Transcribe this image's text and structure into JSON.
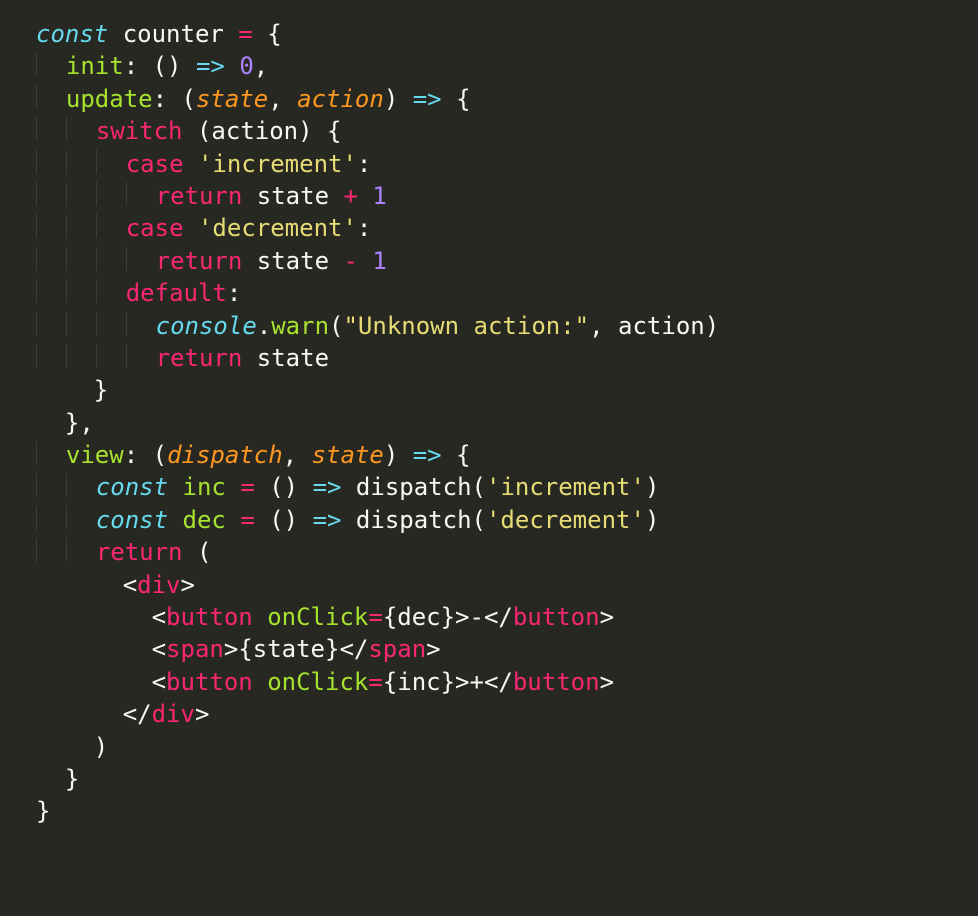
{
  "code": {
    "lines": [
      [
        {
          "cls": "kw-decl",
          "t": "const"
        },
        {
          "cls": "plain",
          "t": " counter "
        },
        {
          "cls": "kw",
          "t": "="
        },
        {
          "cls": "plain",
          "t": " {"
        }
      ],
      [
        {
          "cls": "plain",
          "t": "  "
        },
        {
          "cls": "fname",
          "t": "init"
        },
        {
          "cls": "plain",
          "t": ": () "
        },
        {
          "cls": "kw-decl",
          "t": "=>"
        },
        {
          "cls": "plain",
          "t": " "
        },
        {
          "cls": "num",
          "t": "0"
        },
        {
          "cls": "plain",
          "t": ","
        }
      ],
      [
        {
          "cls": "plain",
          "t": "  "
        },
        {
          "cls": "fname",
          "t": "update"
        },
        {
          "cls": "plain",
          "t": ": ("
        },
        {
          "cls": "param",
          "t": "state"
        },
        {
          "cls": "plain",
          "t": ", "
        },
        {
          "cls": "param",
          "t": "action"
        },
        {
          "cls": "plain",
          "t": ") "
        },
        {
          "cls": "kw-decl",
          "t": "=>"
        },
        {
          "cls": "plain",
          "t": " {"
        }
      ],
      [
        {
          "cls": "plain",
          "t": "    "
        },
        {
          "cls": "kw",
          "t": "switch"
        },
        {
          "cls": "plain",
          "t": " (action) {"
        }
      ],
      [
        {
          "cls": "plain",
          "t": "      "
        },
        {
          "cls": "kw",
          "t": "case"
        },
        {
          "cls": "plain",
          "t": " "
        },
        {
          "cls": "str",
          "t": "'increment'"
        },
        {
          "cls": "plain",
          "t": ":"
        }
      ],
      [
        {
          "cls": "plain",
          "t": "        "
        },
        {
          "cls": "kw",
          "t": "return"
        },
        {
          "cls": "plain",
          "t": " state "
        },
        {
          "cls": "kw",
          "t": "+"
        },
        {
          "cls": "plain",
          "t": " "
        },
        {
          "cls": "num",
          "t": "1"
        }
      ],
      [
        {
          "cls": "plain",
          "t": "      "
        },
        {
          "cls": "kw",
          "t": "case"
        },
        {
          "cls": "plain",
          "t": " "
        },
        {
          "cls": "str",
          "t": "'decrement'"
        },
        {
          "cls": "plain",
          "t": ":"
        }
      ],
      [
        {
          "cls": "plain",
          "t": "        "
        },
        {
          "cls": "kw",
          "t": "return"
        },
        {
          "cls": "plain",
          "t": " state "
        },
        {
          "cls": "kw",
          "t": "-"
        },
        {
          "cls": "plain",
          "t": " "
        },
        {
          "cls": "num",
          "t": "1"
        }
      ],
      [
        {
          "cls": "plain",
          "t": "      "
        },
        {
          "cls": "kw",
          "t": "default"
        },
        {
          "cls": "plain",
          "t": ":"
        }
      ],
      [
        {
          "cls": "plain",
          "t": "        "
        },
        {
          "cls": "obj-ital",
          "t": "console"
        },
        {
          "cls": "plain",
          "t": "."
        },
        {
          "cls": "fname",
          "t": "warn"
        },
        {
          "cls": "plain",
          "t": "("
        },
        {
          "cls": "str",
          "t": "\"Unknown action:\""
        },
        {
          "cls": "plain",
          "t": ", action)"
        }
      ],
      [
        {
          "cls": "plain",
          "t": "        "
        },
        {
          "cls": "kw",
          "t": "return"
        },
        {
          "cls": "plain",
          "t": " state"
        }
      ],
      [
        {
          "cls": "plain",
          "t": "    }"
        }
      ],
      [
        {
          "cls": "plain",
          "t": "  },"
        }
      ],
      [
        {
          "cls": "plain",
          "t": "  "
        },
        {
          "cls": "fname",
          "t": "view"
        },
        {
          "cls": "plain",
          "t": ": ("
        },
        {
          "cls": "param",
          "t": "dispatch"
        },
        {
          "cls": "plain",
          "t": ", "
        },
        {
          "cls": "param",
          "t": "state"
        },
        {
          "cls": "plain",
          "t": ") "
        },
        {
          "cls": "kw-decl",
          "t": "=>"
        },
        {
          "cls": "plain",
          "t": " {"
        }
      ],
      [
        {
          "cls": "plain",
          "t": "    "
        },
        {
          "cls": "kw-decl",
          "t": "const"
        },
        {
          "cls": "plain",
          "t": " "
        },
        {
          "cls": "fname",
          "t": "inc"
        },
        {
          "cls": "plain",
          "t": " "
        },
        {
          "cls": "kw",
          "t": "="
        },
        {
          "cls": "plain",
          "t": " () "
        },
        {
          "cls": "kw-decl",
          "t": "=>"
        },
        {
          "cls": "plain",
          "t": " dispatch("
        },
        {
          "cls": "str",
          "t": "'increment'"
        },
        {
          "cls": "plain",
          "t": ")"
        }
      ],
      [
        {
          "cls": "plain",
          "t": "    "
        },
        {
          "cls": "kw-decl",
          "t": "const"
        },
        {
          "cls": "plain",
          "t": " "
        },
        {
          "cls": "fname",
          "t": "dec"
        },
        {
          "cls": "plain",
          "t": " "
        },
        {
          "cls": "kw",
          "t": "="
        },
        {
          "cls": "plain",
          "t": " () "
        },
        {
          "cls": "kw-decl",
          "t": "=>"
        },
        {
          "cls": "plain",
          "t": " dispatch("
        },
        {
          "cls": "str",
          "t": "'decrement'"
        },
        {
          "cls": "plain",
          "t": ")"
        }
      ],
      [
        {
          "cls": "plain",
          "t": "    "
        },
        {
          "cls": "kw",
          "t": "return"
        },
        {
          "cls": "plain",
          "t": " ("
        }
      ],
      [
        {
          "cls": "plain",
          "t": "      <"
        },
        {
          "cls": "tag",
          "t": "div"
        },
        {
          "cls": "plain",
          "t": ">"
        }
      ],
      [
        {
          "cls": "plain",
          "t": "        <"
        },
        {
          "cls": "tag",
          "t": "button"
        },
        {
          "cls": "plain",
          "t": " "
        },
        {
          "cls": "attr",
          "t": "onClick"
        },
        {
          "cls": "kw",
          "t": "="
        },
        {
          "cls": "plain",
          "t": "{dec}>-</"
        },
        {
          "cls": "tag",
          "t": "button"
        },
        {
          "cls": "plain",
          "t": ">"
        }
      ],
      [
        {
          "cls": "plain",
          "t": "        <"
        },
        {
          "cls": "tag",
          "t": "span"
        },
        {
          "cls": "plain",
          "t": ">{state}</"
        },
        {
          "cls": "tag",
          "t": "span"
        },
        {
          "cls": "plain",
          "t": ">"
        }
      ],
      [
        {
          "cls": "plain",
          "t": "        <"
        },
        {
          "cls": "tag",
          "t": "button"
        },
        {
          "cls": "plain",
          "t": " "
        },
        {
          "cls": "attr",
          "t": "onClick"
        },
        {
          "cls": "kw",
          "t": "="
        },
        {
          "cls": "plain",
          "t": "{inc}>+</"
        },
        {
          "cls": "tag",
          "t": "button"
        },
        {
          "cls": "plain",
          "t": ">"
        }
      ],
      [
        {
          "cls": "plain",
          "t": "      </"
        },
        {
          "cls": "tag",
          "t": "div"
        },
        {
          "cls": "plain",
          "t": ">"
        }
      ],
      [
        {
          "cls": "plain",
          "t": "    )"
        }
      ],
      [
        {
          "cls": "plain",
          "t": "  }"
        }
      ],
      [
        {
          "cls": "plain",
          "t": "}"
        }
      ]
    ]
  }
}
